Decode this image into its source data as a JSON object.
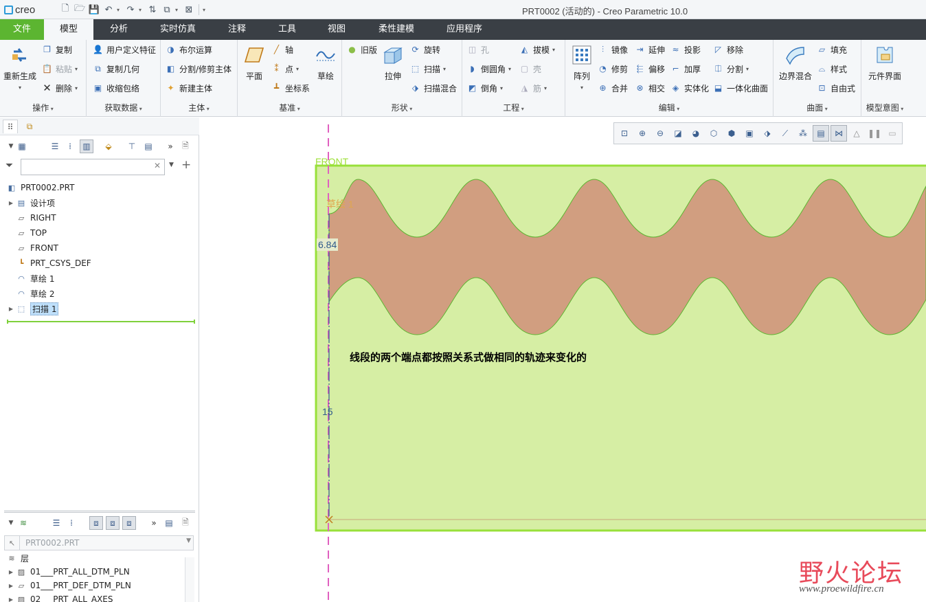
{
  "app": {
    "logo_text": "creo",
    "window_title": "PRT0002 (活动的) - Creo Parametric 10.0"
  },
  "ribbon_tabs": [
    {
      "label": "文件"
    },
    {
      "label": "模型"
    },
    {
      "label": "分析"
    },
    {
      "label": "实时仿真"
    },
    {
      "label": "注释"
    },
    {
      "label": "工具"
    },
    {
      "label": "视图"
    },
    {
      "label": "柔性建模"
    },
    {
      "label": "应用程序"
    }
  ],
  "ribbon": {
    "operations": {
      "label": "操作",
      "regenerate": "重新生成",
      "copy": "复制",
      "paste": "粘贴",
      "delete": "删除"
    },
    "get_data": {
      "label": "获取数据",
      "udf": "用户定义特征",
      "copy_geom": "复制几何",
      "shrinkwrap": "收缩包络"
    },
    "body": {
      "label": "主体",
      "boolean": "布尔运算",
      "split_trim": "分割/修剪主体",
      "new_body": "新建主体"
    },
    "datum": {
      "label": "基准",
      "plane": "平面",
      "axis": "轴",
      "point": "点",
      "csys": "坐标系",
      "sketch": "草绘"
    },
    "shapes": {
      "label": "形状",
      "legacy": "旧版",
      "extrude": "拉伸",
      "revolve": "旋转",
      "sweep": "扫描",
      "swept_blend": "扫描混合"
    },
    "engineering": {
      "label": "工程",
      "hole": "孔",
      "round": "倒圆角",
      "chamfer": "倒角",
      "draft": "拔模",
      "shell": "壳",
      "rib": "筋"
    },
    "editing": {
      "label": "编辑",
      "pattern": "阵列",
      "mirror": "镜像",
      "trim": "修剪",
      "merge": "合并",
      "extend": "延伸",
      "offset": "偏移",
      "intersect": "相交",
      "project": "投影",
      "thicken": "加厚",
      "solidify": "实体化",
      "remove": "移除",
      "split": "分割",
      "unify": "一体化曲面"
    },
    "surfaces": {
      "label": "曲面",
      "boundary_blend": "边界混合",
      "fill": "填充",
      "style": "样式",
      "freestyle": "自由式"
    },
    "model_intent": {
      "label": "模型意图",
      "component_interface": "元件界面"
    }
  },
  "model_tree": {
    "search_placeholder": "",
    "root": "PRT0002.PRT",
    "items": [
      {
        "label": "设计项",
        "icon": "design-items-icon"
      },
      {
        "label": "RIGHT",
        "icon": "datum-plane-icon"
      },
      {
        "label": "TOP",
        "icon": "datum-plane-icon"
      },
      {
        "label": "FRONT",
        "icon": "datum-plane-icon"
      },
      {
        "label": "PRT_CSYS_DEF",
        "icon": "csys-icon"
      },
      {
        "label": "草绘 1",
        "icon": "sketch-icon"
      },
      {
        "label": "草绘 2",
        "icon": "sketch-icon"
      },
      {
        "label": "扫描 1",
        "icon": "sweep-icon"
      }
    ]
  },
  "layer_tree": {
    "model_value": "PRT0002.PRT",
    "header": "层",
    "items": [
      {
        "label": "01___PRT_ALL_DTM_PLN"
      },
      {
        "label": "01___PRT_DEF_DTM_PLN"
      },
      {
        "label": "02___PRT_ALL_AXES"
      }
    ]
  },
  "graphics": {
    "front_label": "FRONT",
    "sketch_label": "草绘 1",
    "dim_upper": "6.84",
    "dim_lower": "15",
    "annotation": "线段的两个端点都按照关系式做相同的轨迹来变化的",
    "colors": {
      "background_plane": "#d6eea4",
      "plane_border": "#98e03a",
      "sweep_band": "#d19e80",
      "datum_axis": "#e060c0"
    }
  },
  "watermark": {
    "title": "野火论坛",
    "url": "www.proewildfire.cn"
  }
}
